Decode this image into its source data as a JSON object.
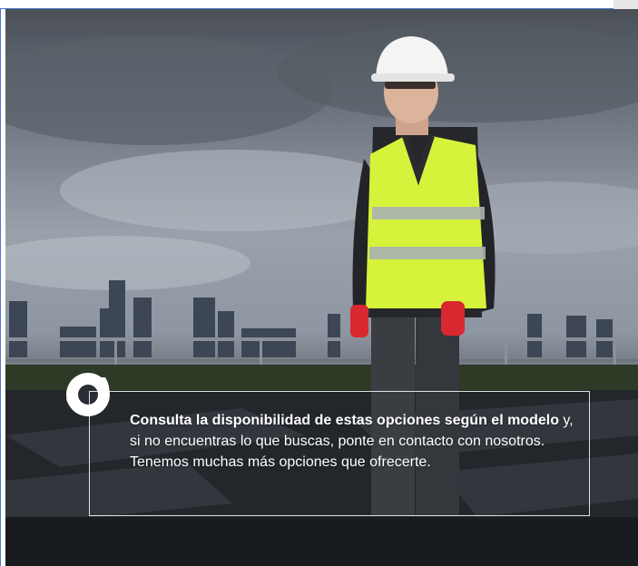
{
  "photo": {
    "alt": "Operario con casco blanco y chaleco reflectante amarillo en una azotea con paneles solares frente al skyline de la ciudad"
  },
  "badge": {
    "icon": "brand-swirl-icon",
    "color": "#ffffff"
  },
  "callout": {
    "bold_text": "Consulta la disponibilidad de estas opciones según el modelo",
    "text": " y, si no encuentras lo que buscas, ponte en contacto con nosotros. Tenemos muchas más opciones que ofrecerte."
  },
  "colors": {
    "accent_frame": "#4b7bc8",
    "vest": "#d7f23a",
    "helmet": "#f4f4f4",
    "glove": "#d9282f"
  }
}
